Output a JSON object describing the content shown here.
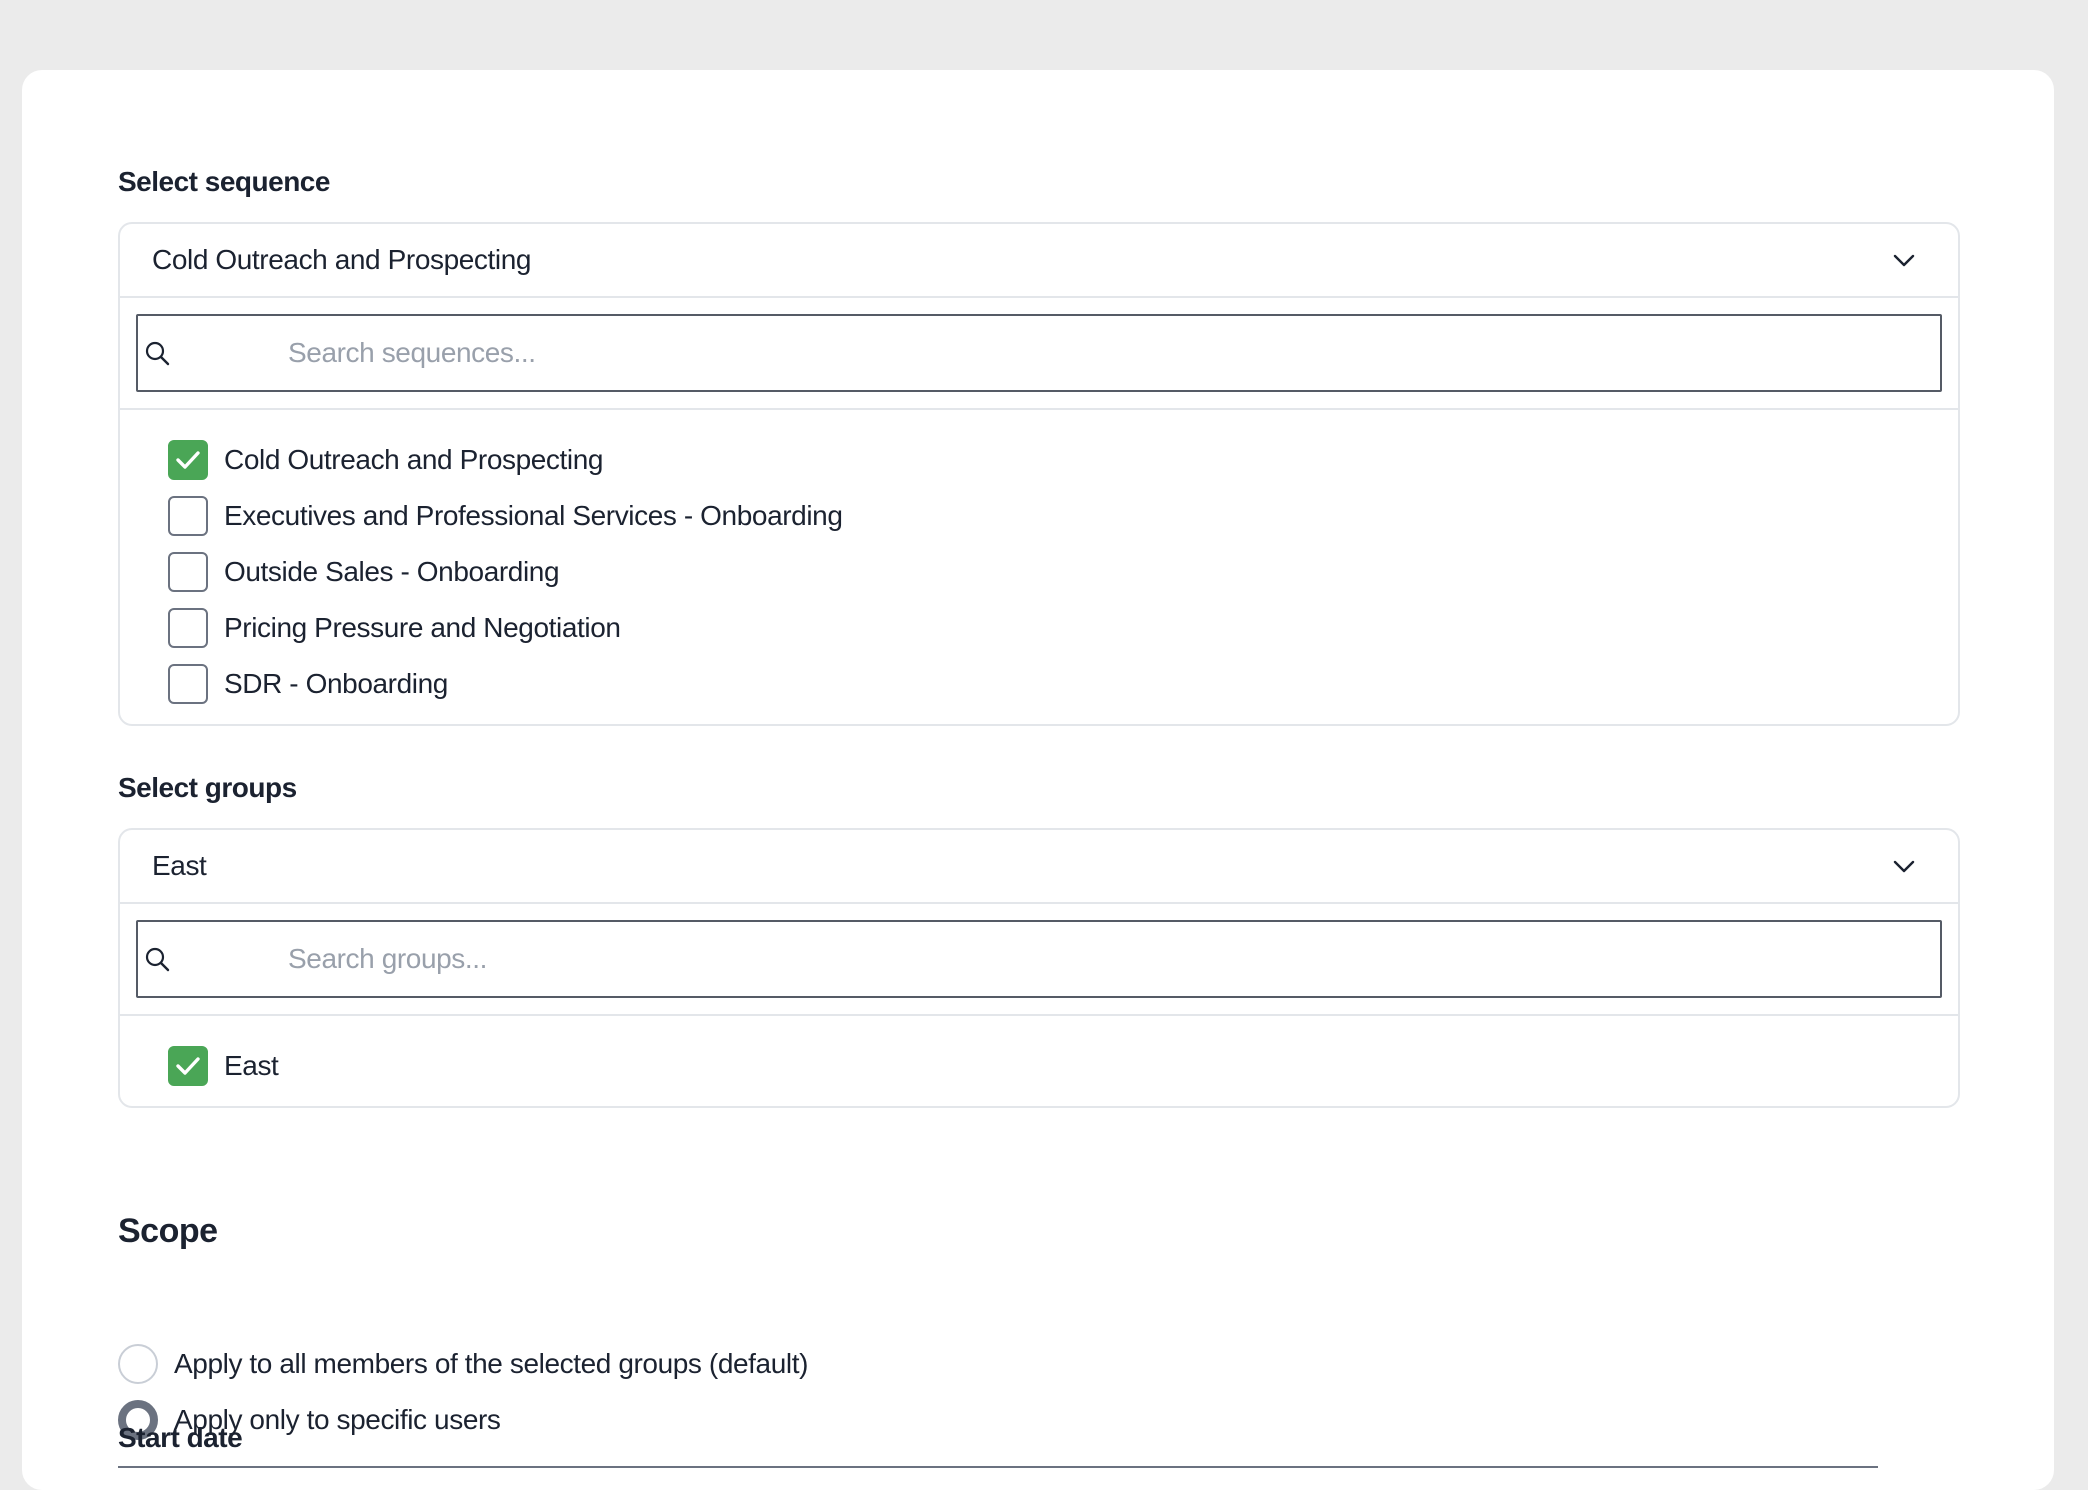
{
  "sequence": {
    "label": "Select sequence",
    "selected_value": "Cold Outreach and Prospecting",
    "search_placeholder": "Search sequences...",
    "options": [
      {
        "label": "Cold Outreach and Prospecting",
        "checked": true
      },
      {
        "label": "Executives and Professional Services - Onboarding",
        "checked": false
      },
      {
        "label": "Outside Sales - Onboarding",
        "checked": false
      },
      {
        "label": "Pricing Pressure and Negotiation",
        "checked": false
      },
      {
        "label": "SDR - Onboarding",
        "checked": false
      }
    ]
  },
  "groups": {
    "label": "Select groups",
    "selected_value": "East",
    "search_placeholder": "Search groups...",
    "options": [
      {
        "label": "East",
        "checked": true
      }
    ]
  },
  "scope": {
    "title": "Scope",
    "options": [
      {
        "label": "Apply to all members of the selected groups (default)",
        "selected": false
      },
      {
        "label": "Apply only to specific users",
        "selected": true
      }
    ]
  },
  "start_date": {
    "label": "Start date"
  },
  "colors": {
    "checkbox_checked": "#4aa656",
    "radio_selected": "#6b7280",
    "text": "#1b2230",
    "placeholder": "#99a0ab"
  }
}
